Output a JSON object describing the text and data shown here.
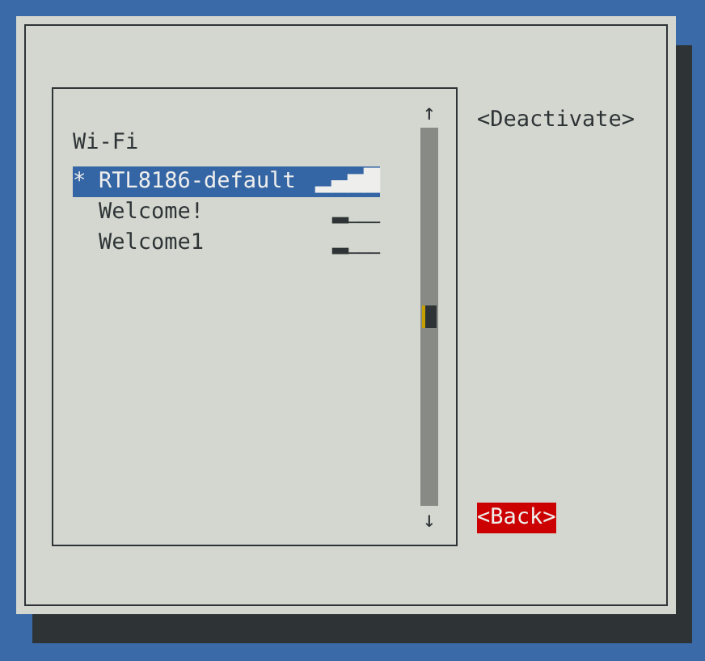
{
  "list": {
    "title": "Wi-Fi",
    "rows": [
      {
        "marker": "*",
        "name": "RTL8186-default",
        "signal": "▂▄▆█",
        "selected": true
      },
      {
        "marker": "",
        "name": "Welcome!",
        "signal": "▂___",
        "selected": false
      },
      {
        "marker": "",
        "name": "Welcome1",
        "signal": "▂___",
        "selected": false
      }
    ],
    "scroll_up": "↑",
    "scroll_down": "↓"
  },
  "buttons": [
    {
      "label": "<Deactivate>",
      "focused": false
    },
    {
      "label": "<Back>",
      "focused": true
    }
  ]
}
